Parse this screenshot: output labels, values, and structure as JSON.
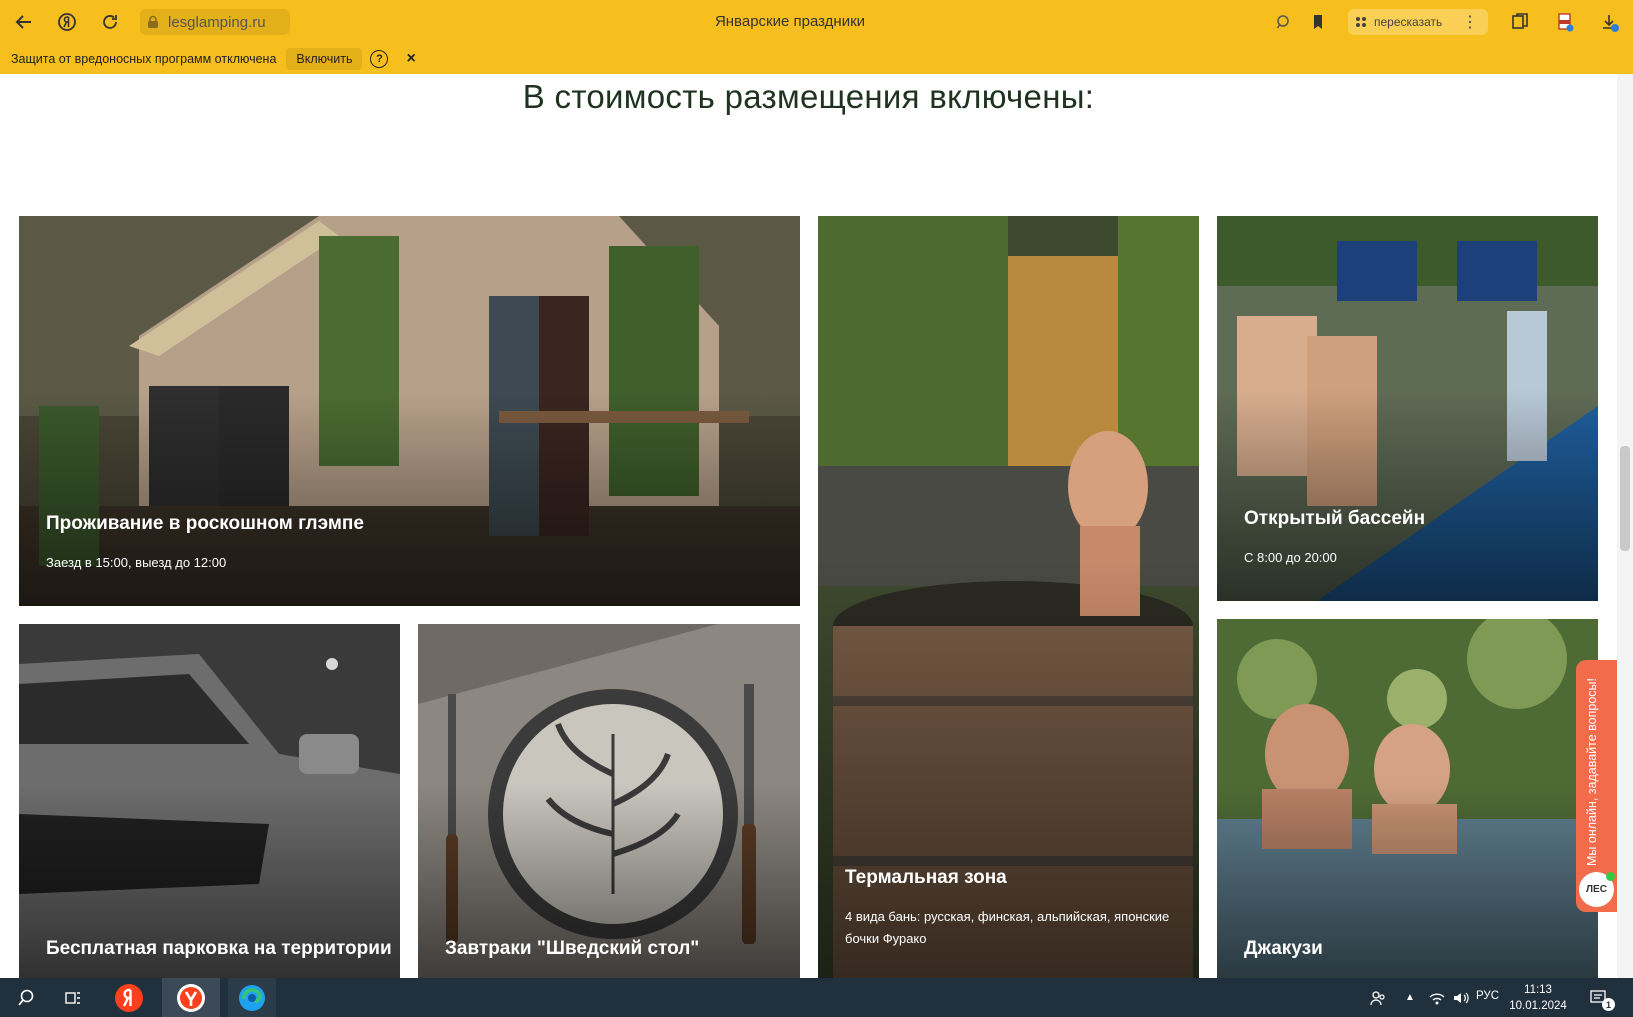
{
  "browser": {
    "url": "lesglamping.ru",
    "page_title": "Январские праздники",
    "retell_label": "пересказать"
  },
  "notification": {
    "text": "Защита от вредоносных программ отключена",
    "enable_label": "Включить",
    "help_label": "?",
    "close_label": "×"
  },
  "page": {
    "heading": "В стоимость размещения включены:",
    "cards": [
      {
        "title": "Проживание в роскошном глэмпе",
        "subtitle": "Заезд в 15:00, выезд до 12:00"
      },
      {
        "title": "Термальная зона",
        "subtitle": "4 вида бань: русская, финская, альпийская, японские бочки Фурако"
      },
      {
        "title": "Открытый бассейн",
        "subtitle": "С 8:00 до 20:00"
      },
      {
        "title": "Бесплатная парковка на территории",
        "subtitle": ""
      },
      {
        "title": "Завтраки \"Шведский стол\"",
        "subtitle": ""
      },
      {
        "title": "Джакузи",
        "subtitle": ""
      }
    ]
  },
  "chat_widget": {
    "text": "Мы онлайн, задавайте вопросы!",
    "logo": "ЛЕС"
  },
  "taskbar": {
    "language": "РУС",
    "time": "11:13",
    "date": "10.01.2024",
    "notification_count": "1"
  },
  "colors": {
    "browser_bar": "#f7bf1d",
    "heading": "#1f3320",
    "chat_accent": "#f26b4b",
    "taskbar": "#21303d"
  }
}
